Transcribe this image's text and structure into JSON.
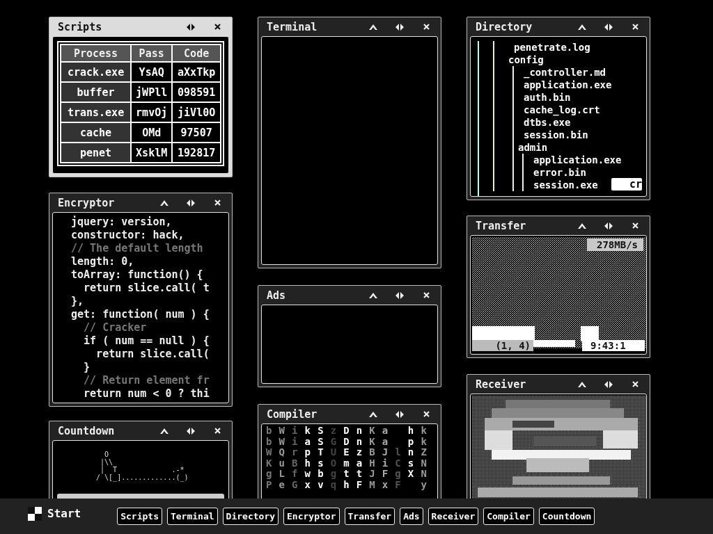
{
  "windows": [
    {
      "title": "Scripts",
      "kind": "table",
      "active": true,
      "collapsible": false,
      "table": {
        "columns": [
          "Process",
          "Pass",
          "Code"
        ],
        "rows": [
          [
            "crack.exe",
            "YsAQ",
            "aXxTkp"
          ],
          [
            "buffer",
            "jWPll",
            "098591"
          ],
          [
            "trans.exe",
            "rmvOj",
            "jiVl0O"
          ],
          [
            "cache",
            "OMd",
            "97507"
          ],
          [
            "penet",
            "XsklM",
            "192817"
          ]
        ]
      }
    },
    {
      "title": "Encryptor",
      "kind": "code",
      "active": false,
      "collapsible": true,
      "lines": [
        {
          "text": "jquery: version,",
          "kind": "code"
        },
        {
          "text": "constructor: hack,",
          "kind": "code"
        },
        {
          "text": "// The default length",
          "kind": "comment"
        },
        {
          "text": "length: 0,",
          "kind": "code"
        },
        {
          "text": "toArray: function() {",
          "kind": "code"
        },
        {
          "text": "  return slice.call( t",
          "kind": "code"
        },
        {
          "text": "},",
          "kind": "code"
        },
        {
          "text": "get: function( num ) {",
          "kind": "code"
        },
        {
          "text": "  // Cracker",
          "kind": "comment"
        },
        {
          "text": "  if ( num == null ) {",
          "kind": "code"
        },
        {
          "text": "    return slice.call(",
          "kind": "code"
        },
        {
          "text": "  }",
          "kind": "code"
        },
        {
          "text": "  // Return element fr",
          "kind": "comment"
        },
        {
          "text": "  return num < 0 ? thi",
          "kind": "code"
        }
      ]
    },
    {
      "title": "Countdown",
      "kind": "countdown",
      "active": false,
      "collapsible": true,
      "art": "    O\n   |\\\\\n   |  T             .-*\n  / \\[_].............(_)"
    },
    {
      "title": "Terminal",
      "kind": "terminal",
      "active": false,
      "collapsible": true
    },
    {
      "title": "Ads",
      "kind": "ads",
      "active": false,
      "collapsible": true
    },
    {
      "title": "Compiler",
      "kind": "compiler",
      "active": false,
      "collapsible": true,
      "rows": [
        "bWikSzDnKa hk",
        "bWiaSGDnKa pk",
        "WQrpTUEzBJlnZ",
        "KuBhsOmaHiCsN",
        "gLfwbgttJFgXN",
        "PeGxvqhFMxF y"
      ]
    },
    {
      "title": "Directory",
      "kind": "tree",
      "active": false,
      "collapsible": true,
      "tree": [
        {
          "name": "penetrate.log"
        },
        {
          "name": "config",
          "children": [
            {
              "name": "_controller.md"
            },
            {
              "name": "application.exe"
            },
            {
              "name": "auth.bin"
            },
            {
              "name": "cache_log.crt"
            },
            {
              "name": "dtbs.exe"
            },
            {
              "name": "session.bin"
            },
            {
              "name": "admin",
              "children": [
                {
                  "name": "application.exe"
                },
                {
                  "name": "error.bin"
                },
                {
                  "name": "session.exe"
                }
              ]
            }
          ]
        }
      ],
      "tag": "cr"
    },
    {
      "title": "Transfer",
      "kind": "transfer",
      "active": false,
      "collapsible": true,
      "rate": "278MB/s",
      "position": "(1, 4)",
      "time": "9:43:1"
    },
    {
      "title": "Receiver",
      "kind": "receiver",
      "active": false,
      "collapsible": true
    }
  ],
  "taskbar": {
    "start": "Start",
    "buttons": [
      "Scripts",
      "Terminal",
      "Directory",
      "Encryptor",
      "Transfer",
      "Ads",
      "Receiver",
      "Compiler",
      "Countdown"
    ]
  }
}
